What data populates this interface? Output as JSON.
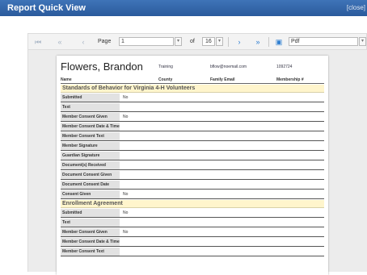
{
  "window": {
    "title": "Report Quick View",
    "close_label": "[close]"
  },
  "toolbar": {
    "page_label": "Page",
    "page_value": "1",
    "of_label": "of",
    "page_count": "16",
    "format_value": "Pdf",
    "accent": "#2f7fd1"
  },
  "header": {
    "member_name": "Flowers, Brandon",
    "county": "Training",
    "family_email": "bflow@noemail.com",
    "membership_no": "1092724",
    "columns": {
      "name": "Name",
      "county": "County",
      "family_email": "Family Email",
      "membership": "Membership #"
    }
  },
  "sections": [
    {
      "title": "Standards of Behavior for Virginia 4-H Volunteers",
      "rows": [
        {
          "label": "Submitted",
          "value": "No"
        },
        {
          "label": "Text",
          "value": ""
        },
        {
          "label": "Member Consent Given",
          "value": "No"
        },
        {
          "label": "Member Consent Date & Time",
          "value": ""
        },
        {
          "label": "Member Consent Text",
          "value": ""
        },
        {
          "label": "Member Signature",
          "value": ""
        },
        {
          "label": "Guardian Signature",
          "value": ""
        },
        {
          "label": "Document(s) Received",
          "value": ""
        },
        {
          "label": "Document Consent Given",
          "value": ""
        },
        {
          "label": "Document Consent Date",
          "value": ""
        },
        {
          "label": "Consent Given",
          "value": "No"
        }
      ]
    },
    {
      "title": "Enrollment Agreement",
      "rows": [
        {
          "label": "Submitted",
          "value": "No"
        },
        {
          "label": "Text",
          "value": ""
        },
        {
          "label": "Member Consent Given",
          "value": "No"
        },
        {
          "label": "Member Consent Date & Time",
          "value": ""
        },
        {
          "label": "Member Consent Text",
          "value": ""
        }
      ]
    }
  ]
}
